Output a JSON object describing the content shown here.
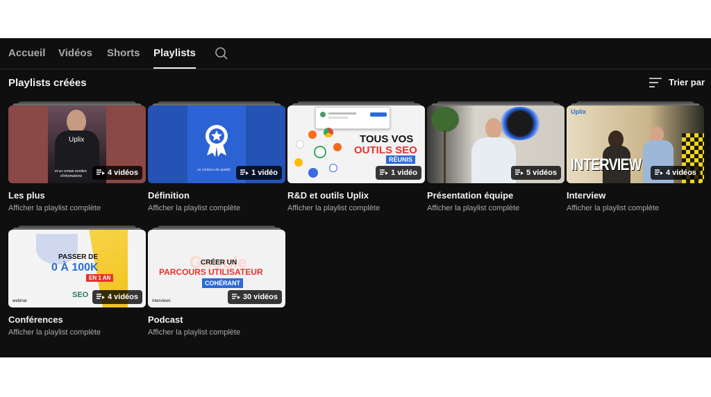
{
  "tabs": [
    {
      "label": "Accueil"
    },
    {
      "label": "Vidéos"
    },
    {
      "label": "Shorts"
    },
    {
      "label": "Playlists",
      "active": true
    }
  ],
  "search_icon": "search-icon",
  "section": {
    "title": "Playlists créées"
  },
  "sort": {
    "label": "Trier par",
    "icon": "sort-icon"
  },
  "playlist_link_label": "Afficher la playlist complète",
  "playlists": [
    {
      "title": "Les plus",
      "count": "4 vidéos",
      "thumb_text": [
        "Uplix",
        "et un certain nombre",
        "d'informations"
      ]
    },
    {
      "title": "Définition",
      "count": "1 vidéo",
      "thumb_text": [
        "un contenu de qualité"
      ]
    },
    {
      "title": "R&D et outils Uplix",
      "count": "1 vidéo",
      "thumb_text": [
        "TOUS VOS",
        "OUTILS SEO",
        "RÉUNIS"
      ]
    },
    {
      "title": "Présentation équipe",
      "count": "5 vidéos",
      "thumb_text": []
    },
    {
      "title": "Interview",
      "count": "4 vidéos",
      "thumb_text": [
        "INTERVIEW",
        "Uplix"
      ]
    },
    {
      "title": "Conférences",
      "count": "4 vidéos",
      "thumb_text": [
        "PASSER DE",
        "0 À 100K",
        "EN 1 AN",
        "SEO",
        "webinar"
      ]
    },
    {
      "title": "Podcast",
      "count": "30 vidéos",
      "thumb_text": [
        "CRÉER UN",
        "PARCOURS UTILISATEUR",
        "COHÉRANT",
        "Google",
        "interviews"
      ]
    }
  ],
  "colors": {
    "background": "#0f0f0f",
    "text": "#f1f1f1",
    "muted": "#aaaaaa",
    "accent_red": "#e5322e",
    "accent_blue": "#2b6bd6"
  }
}
